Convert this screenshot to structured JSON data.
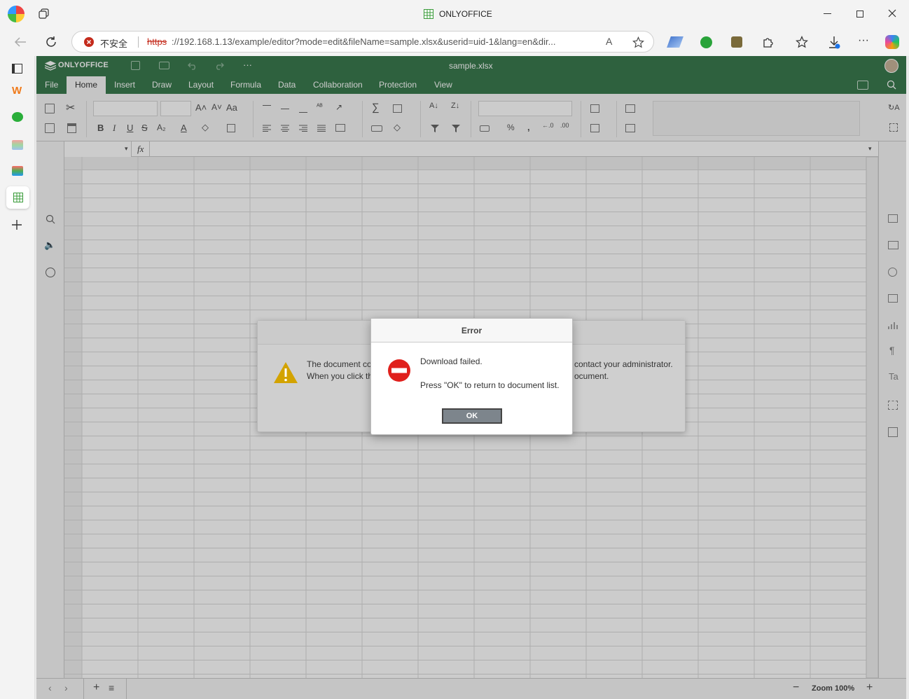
{
  "window": {
    "title": "ONLYOFFICE"
  },
  "address": {
    "security_label": "不安全",
    "url_scheme": "https",
    "url_rest": "://192.168.1.13/example/editor?mode=edit&fileName=sample.xlsx&userid=uid-1&lang=en&dir..."
  },
  "editor": {
    "brand": "ONLYOFFICE",
    "file_name": "sample.xlsx",
    "tabs": [
      "File",
      "Home",
      "Insert",
      "Draw",
      "Layout",
      "Formula",
      "Data",
      "Collaboration",
      "Protection",
      "View"
    ],
    "active_tab": "Home",
    "formula_label": "fx",
    "zoom_label": "Zoom 100%",
    "accent_color": "#3a7a4e"
  },
  "warning_dialog": {
    "line1_left": "The document co",
    "line1_right": "contact your administrator.",
    "line2_left": "When you click th",
    "line2_right": "ocument."
  },
  "error_dialog": {
    "title": "Error",
    "message": "Download failed.",
    "hint": "Press \"OK\" to return to document list.",
    "ok_label": "OK"
  }
}
